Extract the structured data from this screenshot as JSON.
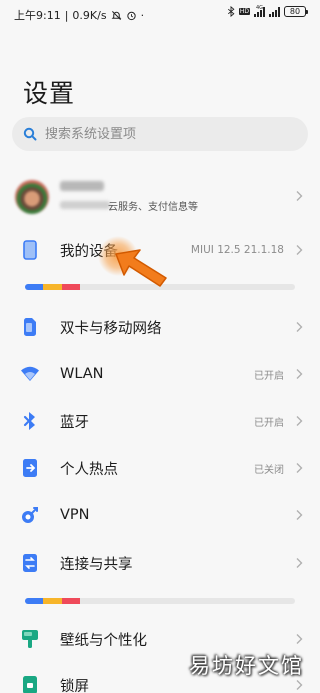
{
  "status_bar": {
    "time": "上午9:11",
    "speed": "0.9K/s",
    "battery": "80",
    "network": "4G"
  },
  "page_title": "设置",
  "search": {
    "placeholder": "搜索系统设置项"
  },
  "account": {
    "subtitle": "云服务、支付信息等"
  },
  "device": {
    "label": "我的设备",
    "value": "MIUI 12.5 21.1.18"
  },
  "storage_segments": [
    {
      "color": "#3d7cf5"
    },
    {
      "color": "#f7b52a"
    },
    {
      "color": "#ef4a5a"
    }
  ],
  "menu": [
    {
      "label": "双卡与移动网络",
      "value": "",
      "icon": "sim-card-icon"
    },
    {
      "label": "WLAN",
      "value": "已开启",
      "icon": "wifi-icon"
    },
    {
      "label": "蓝牙",
      "value": "已开启",
      "icon": "bluetooth-icon"
    },
    {
      "label": "个人热点",
      "value": "已关闭",
      "icon": "hotspot-icon"
    },
    {
      "label": "VPN",
      "value": "",
      "icon": "vpn-icon"
    },
    {
      "label": "连接与共享",
      "value": "",
      "icon": "connection-share-icon"
    },
    {
      "label": "壁纸与个性化",
      "value": "",
      "icon": "wallpaper-icon"
    },
    {
      "label": "锁屏",
      "value": "",
      "icon": "lock-screen-icon"
    }
  ],
  "colors": {
    "accent_blue": "#3d7cf5",
    "teal": "#1aa883",
    "pointer_orange": "#f27c1c"
  },
  "watermark": "易坊好文馆"
}
